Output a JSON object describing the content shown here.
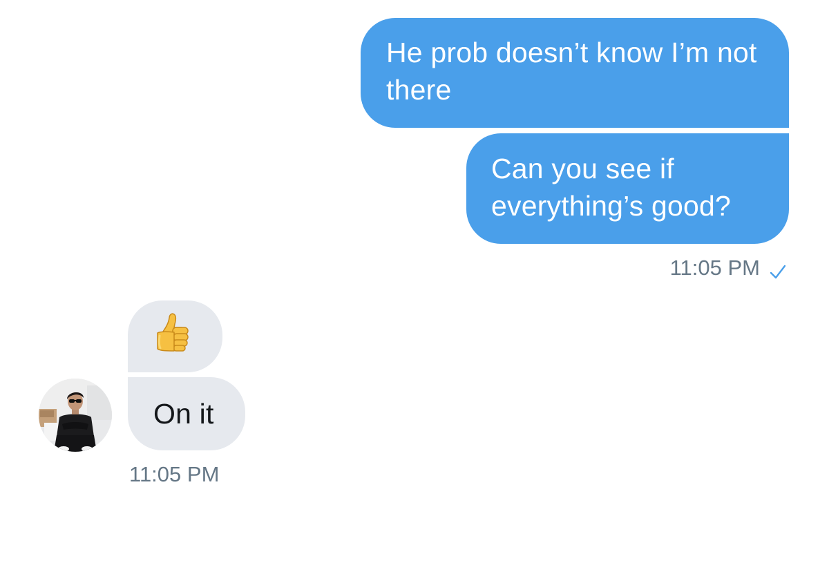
{
  "conversation": {
    "sent_messages": [
      {
        "text": "He prob doesn’t know I’m not there"
      },
      {
        "text": "Can you see if everything’s good?"
      }
    ],
    "sent_timestamp": "11:05 PM",
    "sent_status_icon": "checkmark-icon",
    "received_messages": [
      {
        "emoji": "thumbs-up-icon"
      },
      {
        "text": "On it"
      }
    ],
    "received_timestamp": "11:05 PM",
    "avatar_icon": "user-avatar"
  },
  "colors": {
    "sent_bubble": "#4a9fea",
    "received_bubble": "#e6e9ee",
    "timestamp": "#657786",
    "check": "#4a9fea"
  }
}
